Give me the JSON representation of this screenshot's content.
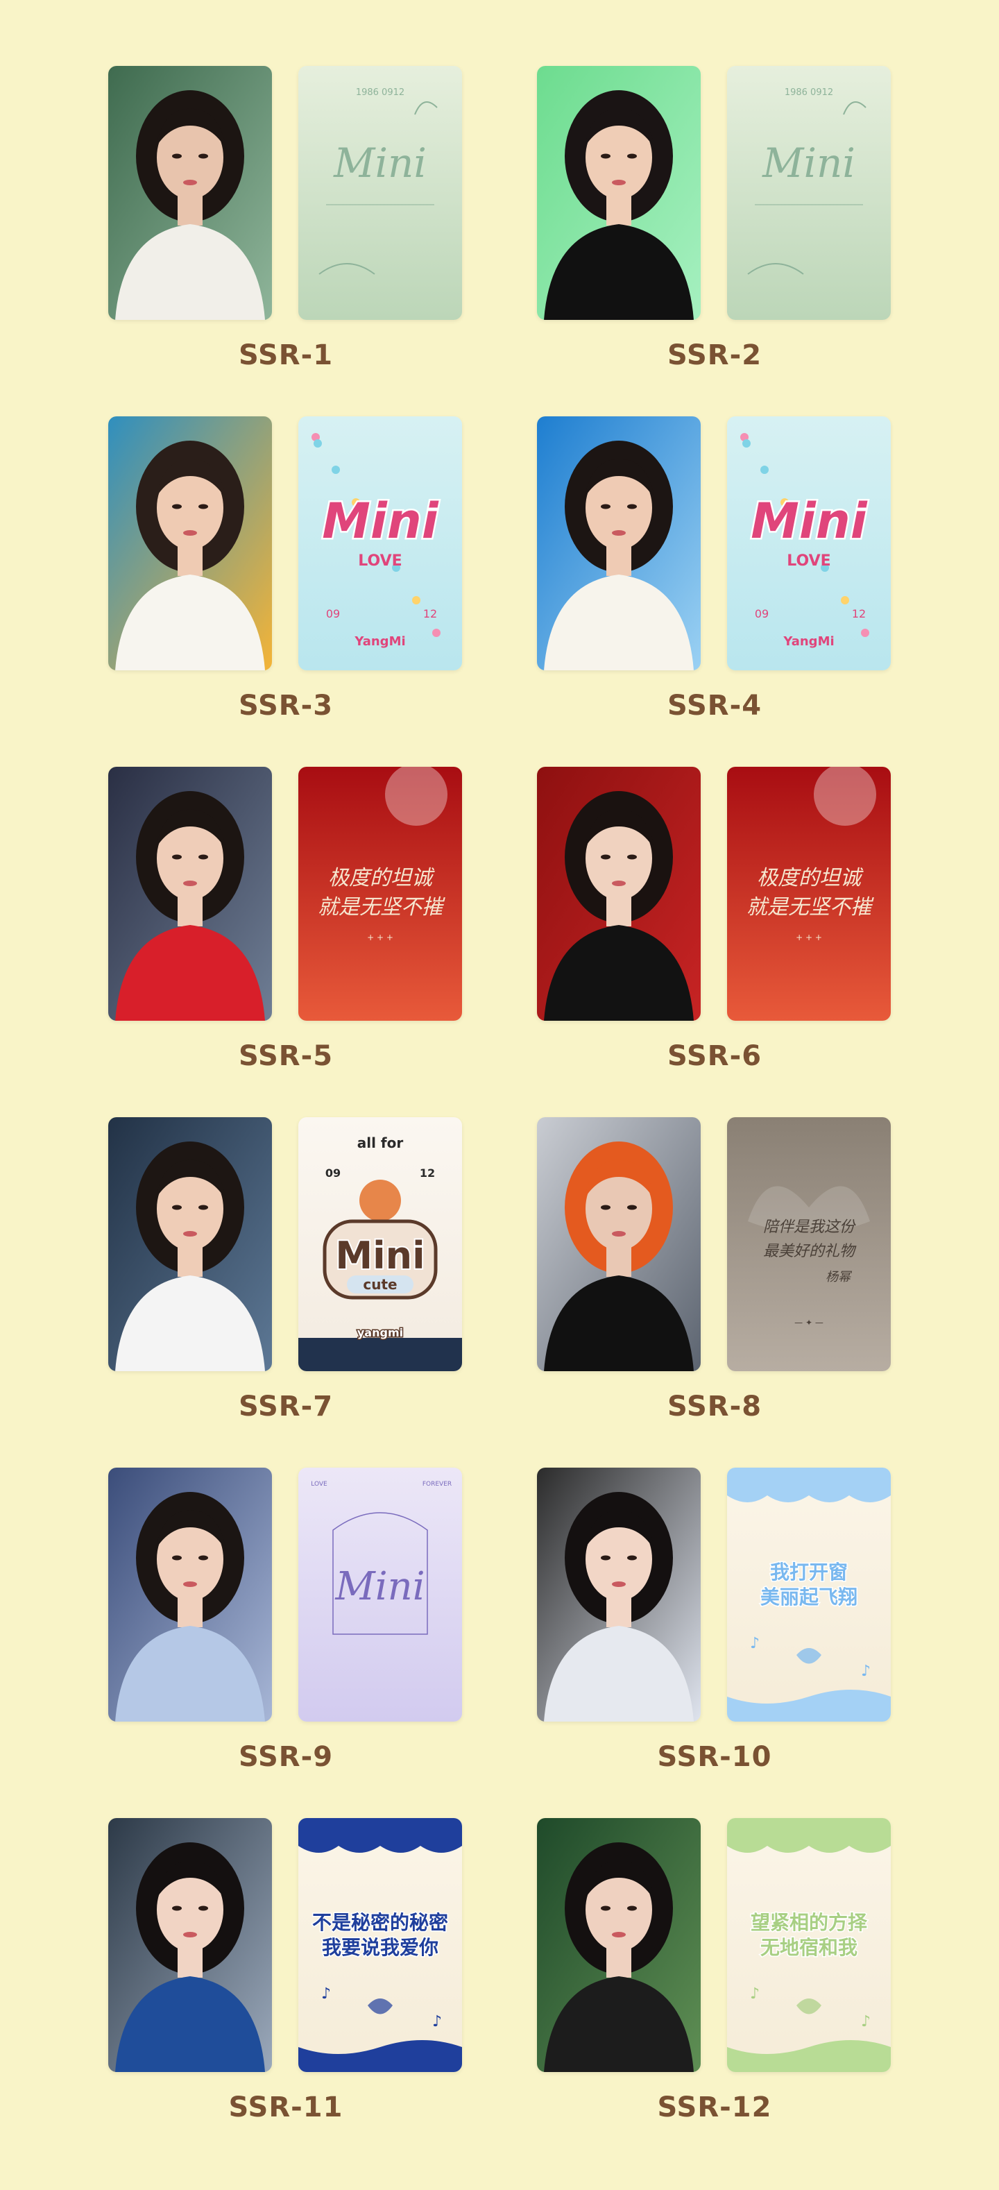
{
  "items": [
    {
      "label": "SSR-1",
      "photo": {
        "bg": [
          "#3f6b4f",
          "#8fb59a"
        ],
        "hair": "#1c1512",
        "top": "#f1efe9",
        "skin": "#e8c4ad"
      },
      "back": {
        "kind": "mini-script",
        "bg": [
          "#e6efdd",
          "#bcd6b8"
        ],
        "ink": "#8eb39a",
        "lines": [
          "1986 0912",
          "Mini"
        ]
      }
    },
    {
      "label": "SSR-2",
      "photo": {
        "bg": [
          "#6ddc8f",
          "#a6f0c0"
        ],
        "hair": "#1a1414",
        "top": "#111111",
        "skin": "#efcdb6"
      },
      "back": {
        "kind": "mini-script",
        "bg": [
          "#e6efdd",
          "#bcd6b8"
        ],
        "ink": "#8eb39a",
        "lines": [
          "1986 0912",
          "Mini"
        ]
      }
    },
    {
      "label": "SSR-3",
      "photo": {
        "bg": [
          "#2f8fbf",
          "#f4b437"
        ],
        "hair": "#2a1e19",
        "top": "#f7f5ef",
        "skin": "#efcbb3"
      },
      "back": {
        "kind": "mini-love",
        "bg": [
          "#d7f1f3",
          "#b9e6ee"
        ],
        "ink": "#e0457b",
        "lines": [
          "Mini",
          "LOVE",
          "09",
          "12",
          "YangMi"
        ]
      }
    },
    {
      "label": "SSR-4",
      "photo": {
        "bg": [
          "#1e7ed0",
          "#9bd1f3"
        ],
        "hair": "#1c1513",
        "top": "#f7f4ec",
        "skin": "#efcbb4"
      },
      "back": {
        "kind": "mini-love",
        "bg": [
          "#d7f1f3",
          "#b9e6ee"
        ],
        "ink": "#e0457b",
        "lines": [
          "Mini",
          "LOVE",
          "09",
          "12",
          "YangMi"
        ]
      }
    },
    {
      "label": "SSR-5",
      "photo": {
        "bg": [
          "#2a2f44",
          "#6f7e95"
        ],
        "hair": "#1c1512",
        "top": "#d81f2a",
        "skin": "#efcdb8"
      },
      "back": {
        "kind": "red-calligraphy",
        "bg": [
          "#a80d12",
          "#e85a3a"
        ],
        "ink": "#f6e6cf",
        "lines": [
          "极度的坦诚",
          "就是无坚不摧"
        ]
      }
    },
    {
      "label": "SSR-6",
      "photo": {
        "bg": [
          "#8e1010",
          "#c72424"
        ],
        "hair": "#1a1210",
        "top": "#121212",
        "skin": "#f0d2bf"
      },
      "back": {
        "kind": "red-calligraphy",
        "bg": [
          "#a80d12",
          "#e85a3a"
        ],
        "ink": "#f6e6cf",
        "lines": [
          "极度的坦诚",
          "就是无坚不摧"
        ]
      }
    },
    {
      "label": "SSR-7",
      "photo": {
        "bg": [
          "#223246",
          "#5d7895"
        ],
        "hair": "#1d1613",
        "top": "#f4f4f4",
        "skin": "#efcdb7"
      },
      "back": {
        "kind": "mini-cute",
        "bg": [
          "#fbf7f1",
          "#f3ebe0"
        ],
        "ink": "#5b3a2a",
        "lines": [
          "all for",
          "09",
          "12",
          "Mini",
          "cute",
          "yangmi"
        ]
      }
    },
    {
      "label": "SSR-8",
      "photo": {
        "bg": [
          "#c9ccd2",
          "#5c6470"
        ],
        "hair": "#e45a1f",
        "top": "#111111",
        "skin": "#e9c8b4"
      },
      "back": {
        "kind": "grey-calligraphy",
        "bg": [
          "#8a8074",
          "#b7ada2"
        ],
        "ink": "#4a4038",
        "lines": [
          "陪伴是我这份",
          "最美好的礼物",
          "杨幂"
        ]
      }
    },
    {
      "label": "SSR-9",
      "photo": {
        "bg": [
          "#3b4d7a",
          "#a7b6d6"
        ],
        "hair": "#1b1513",
        "top": "#b5c8e6",
        "skin": "#f0d0bd"
      },
      "back": {
        "kind": "mini-lavender",
        "bg": [
          "#ece7f7",
          "#d2cbef"
        ],
        "ink": "#7a6bbd",
        "lines": [
          "LOVE",
          "FOREVER",
          "Mini"
        ]
      }
    },
    {
      "label": "SSR-10",
      "photo": {
        "bg": [
          "#2b2b2b",
          "#dfe4ee"
        ],
        "hair": "#141010",
        "top": "#e6e9ef",
        "skin": "#f2d6c6"
      },
      "back": {
        "kind": "blue-calligraphy",
        "bg": [
          "#fbf5e8",
          "#f5ecd8"
        ],
        "ink": "#79b8ef",
        "lines": [
          "我打开窗",
          "美丽起飞翔"
        ]
      }
    },
    {
      "label": "SSR-11",
      "photo": {
        "bg": [
          "#2d3a48",
          "#9ba9bb"
        ],
        "hair": "#141010",
        "top": "#1f4d9a",
        "skin": "#f1d4c4"
      },
      "back": {
        "kind": "navy-calligraphy",
        "bg": [
          "#fbf5e8",
          "#f5ecd8"
        ],
        "ink": "#1f3f9c",
        "lines": [
          "不是秘密的秘密",
          "我要说我爱你"
        ]
      }
    },
    {
      "label": "SSR-12",
      "photo": {
        "bg": [
          "#1f4a2a",
          "#5f8f54"
        ],
        "hair": "#141010",
        "top": "#1c1c1c",
        "skin": "#efd1c0"
      },
      "back": {
        "kind": "green-calligraphy",
        "bg": [
          "#fbf5e8",
          "#f5ecd8"
        ],
        "ink": "#a8cf83",
        "lines": [
          "望紧相的方择",
          "无地宿和我"
        ]
      }
    }
  ]
}
